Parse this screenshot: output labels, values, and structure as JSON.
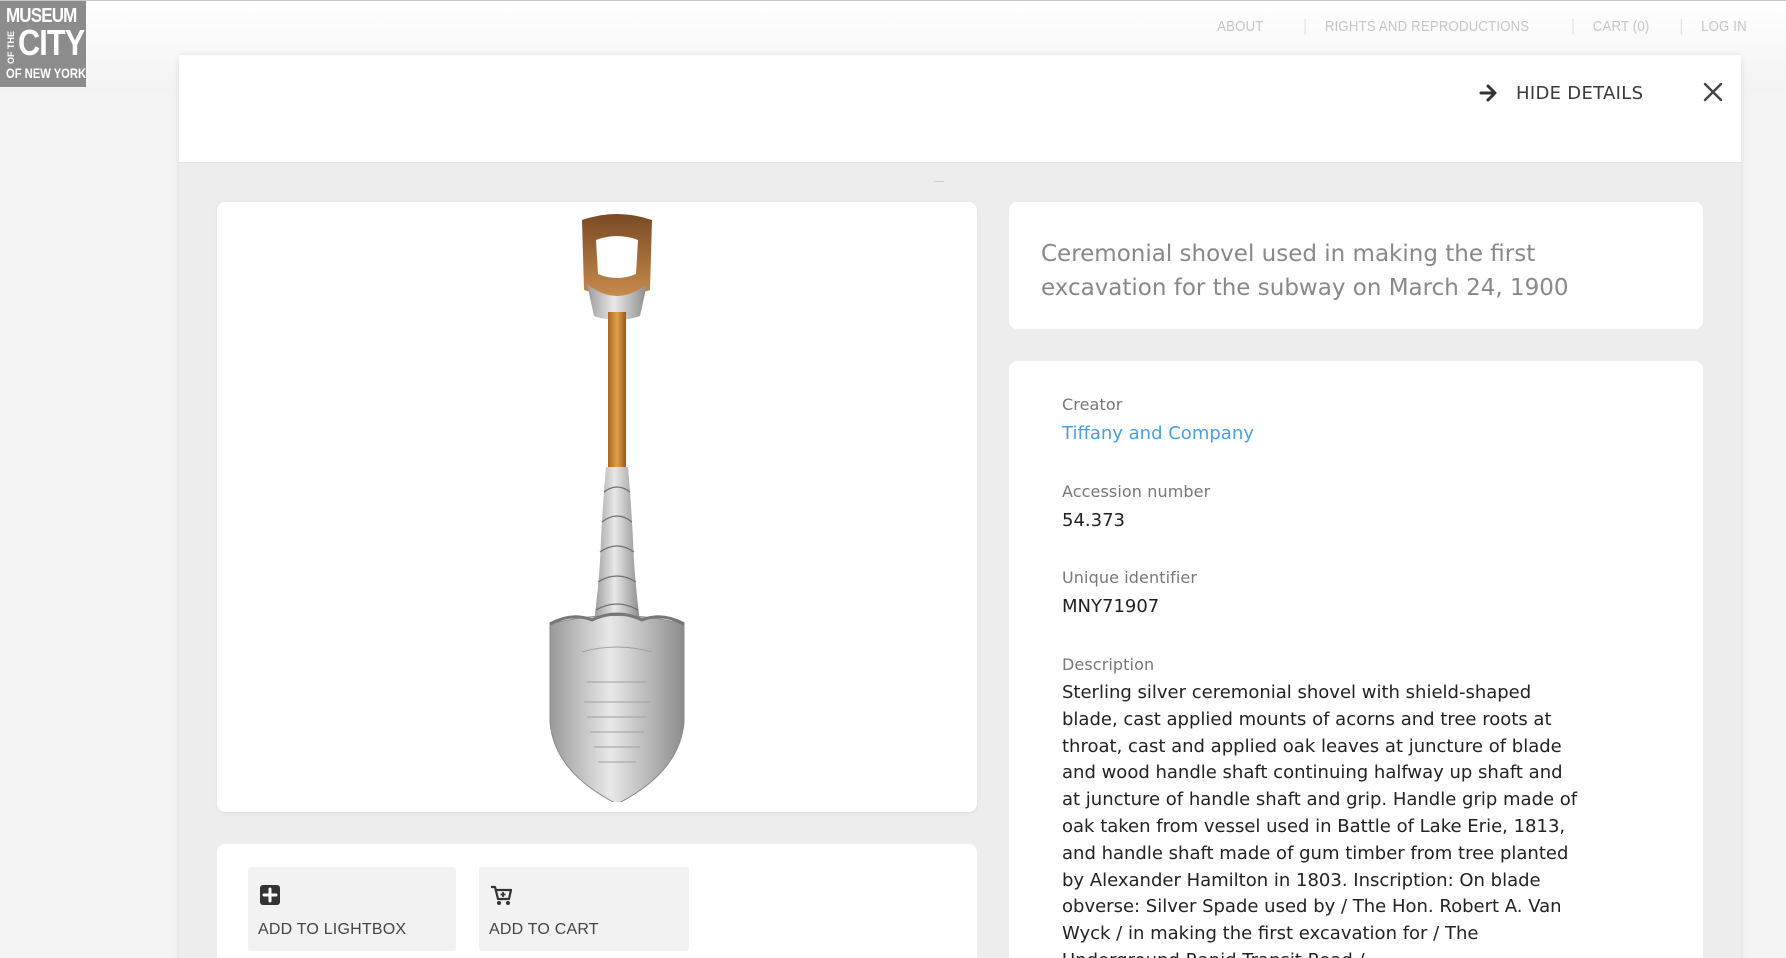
{
  "logo": {
    "line1": "MUSEUM",
    "vertical": "OF THE",
    "line2": "CITY",
    "line3": "OF NEW YORK"
  },
  "topnav": {
    "items": [
      "ABOUT",
      "RIGHTS AND REPRODUCTIONS",
      "CART (0)",
      "LOG IN"
    ]
  },
  "modal": {
    "hide_details_label": "HIDE DETAILS",
    "title": "Ceremonial shovel used in making the first excavation for the subway on March 24, 1900"
  },
  "actions": {
    "lightbox_label": "ADD TO LIGHTBOX",
    "cart_label": "ADD TO CART"
  },
  "details": {
    "creator_label": "Creator",
    "creator_value": "Tiffany and Company",
    "accession_label": "Accession number",
    "accession_value": "54.373",
    "identifier_label": "Unique identifier",
    "identifier_value": "MNY71907",
    "description_label": "Description",
    "description_value": "Sterling silver ceremonial shovel with shield-shaped blade, cast applied mounts of acorns and tree roots at throat, cast and applied oak leaves at juncture of blade and wood handle shaft continuing halfway up shaft and at juncture of handle shaft and grip. Handle grip made of oak taken from vessel used in Battle of Lake Erie, 1813, and handle shaft made of gum timber from tree planted by Alexander Hamilton in 1803. Inscription: On blade obverse: Silver Spade used by / The Hon. Robert A. Van Wyck / in making the first excavation for / The Underground Rapid Transit Road /"
  },
  "colors": {
    "link": "#4a9fe0",
    "logo_bg": "#8c8c8c",
    "modal_bg": "#ededee"
  },
  "icons": [
    "arrow-right-icon",
    "close-icon",
    "plus-square-icon",
    "cart-icon"
  ]
}
